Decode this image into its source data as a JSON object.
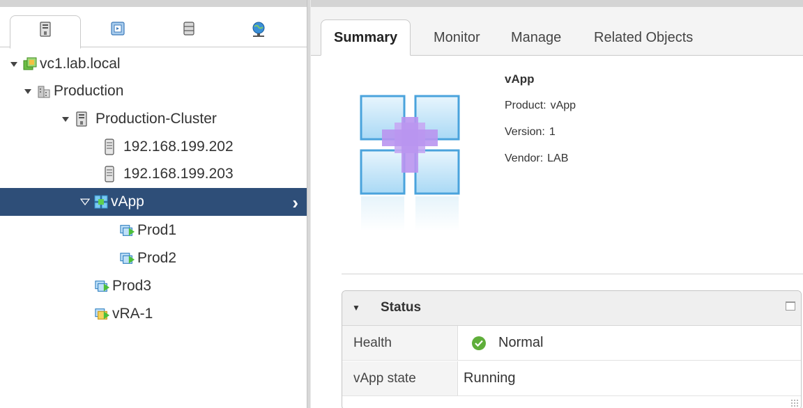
{
  "navigator": {
    "tabs": [
      {
        "icon": "hosts-and-clusters-icon"
      },
      {
        "icon": "vms-and-templates-icon"
      },
      {
        "icon": "storage-icon"
      },
      {
        "icon": "networking-icon"
      }
    ],
    "tree": [
      {
        "label": "vc1.lab.local",
        "icon": "vcenter-icon",
        "expanded": true
      },
      {
        "label": "Production",
        "icon": "datacenter-icon",
        "expanded": true
      },
      {
        "label": "Production-Cluster",
        "icon": "cluster-icon",
        "expanded": true
      },
      {
        "label": "192.168.199.202",
        "icon": "host-icon"
      },
      {
        "label": "192.168.199.203",
        "icon": "host-icon"
      },
      {
        "label": "vApp",
        "icon": "vapp-icon",
        "expanded": true,
        "selected": true
      },
      {
        "label": "Prod1",
        "icon": "vm-icon"
      },
      {
        "label": "Prod2",
        "icon": "vm-icon"
      },
      {
        "label": "Prod3",
        "icon": "vm-icon"
      },
      {
        "label": "vRA-1",
        "icon": "vm-yellow-icon"
      }
    ]
  },
  "content": {
    "tabs": [
      "Summary",
      "Monitor",
      "Manage",
      "Related Objects"
    ],
    "active_tab": "Summary",
    "summary": {
      "title": "vApp",
      "product_label": "Product:",
      "product_value": "vApp",
      "version_label": "Version:",
      "version_value": "1",
      "vendor_label": "Vendor:",
      "vendor_value": "LAB"
    },
    "status": {
      "title": "Status",
      "rows": [
        {
          "label": "Health",
          "value": "Normal",
          "icon": "check-circle-icon"
        },
        {
          "label": "vApp state",
          "value": "Running"
        }
      ]
    }
  },
  "colors": {
    "selection": "#2e4e78",
    "ok": "#5fae3a",
    "tab_bar": "#f4f4f4"
  }
}
